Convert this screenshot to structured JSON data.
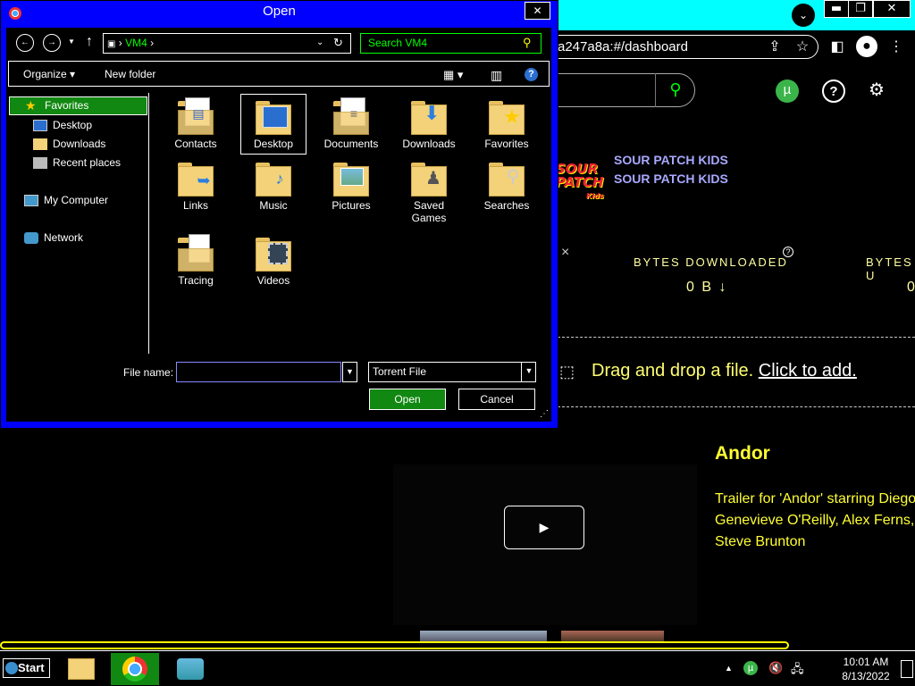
{
  "browser": {
    "url": "a247a8a:#/dashboard",
    "window_min": "▬",
    "window_restore": "❐",
    "window_close": "✕"
  },
  "site": {
    "search_icon": "search-icon",
    "sponsor_links": [
      "SOUR PATCH KIDS",
      "SOUR PATCH KIDS"
    ],
    "sponsor_logo": [
      "SOUR",
      "PATCH",
      "Kids"
    ],
    "stats": [
      {
        "label": "BYTES DOWNLOADED",
        "value": "0 B ↓"
      },
      {
        "label": "BYTES U",
        "value": "0"
      }
    ],
    "dismiss": "×",
    "drop_text": "Drag and drop a file.",
    "drop_click": "Click to add.",
    "video_title": "Andor",
    "video_desc": "Trailer for 'Andor' starring Diego\nGenevieve O'Reilly, Alex Ferns,\nSteve Brunton",
    "play_icon": "▶"
  },
  "dialog": {
    "title": "Open",
    "path": [
      "VM4"
    ],
    "search_placeholder": "Search VM4",
    "organize": "Organize ▾",
    "new_folder": "New folder",
    "nav": [
      {
        "label": "Favorites"
      },
      {
        "label": "Desktop"
      },
      {
        "label": "Downloads"
      },
      {
        "label": "Recent places"
      },
      {
        "label": "My Computer"
      },
      {
        "label": "Network"
      }
    ],
    "folders": [
      "Contacts",
      "Desktop",
      "Documents",
      "Downloads",
      "Favorites",
      "Links",
      "Music",
      "Pictures",
      "Saved\nGames",
      "Searches",
      "Tracing",
      "Videos"
    ],
    "file_name_label": "File name:",
    "file_name_value": "",
    "file_type": "Torrent File",
    "open_label": "Open",
    "cancel_label": "Cancel"
  },
  "taskbar": {
    "start_label": "Start",
    "time": "10:01 AM",
    "date": "8/13/2022"
  },
  "colors": {
    "accent_green": "#118811",
    "dialog_frame": "#0000ff",
    "chrome_top": "#00ffff",
    "site_text": "#ffff33"
  }
}
